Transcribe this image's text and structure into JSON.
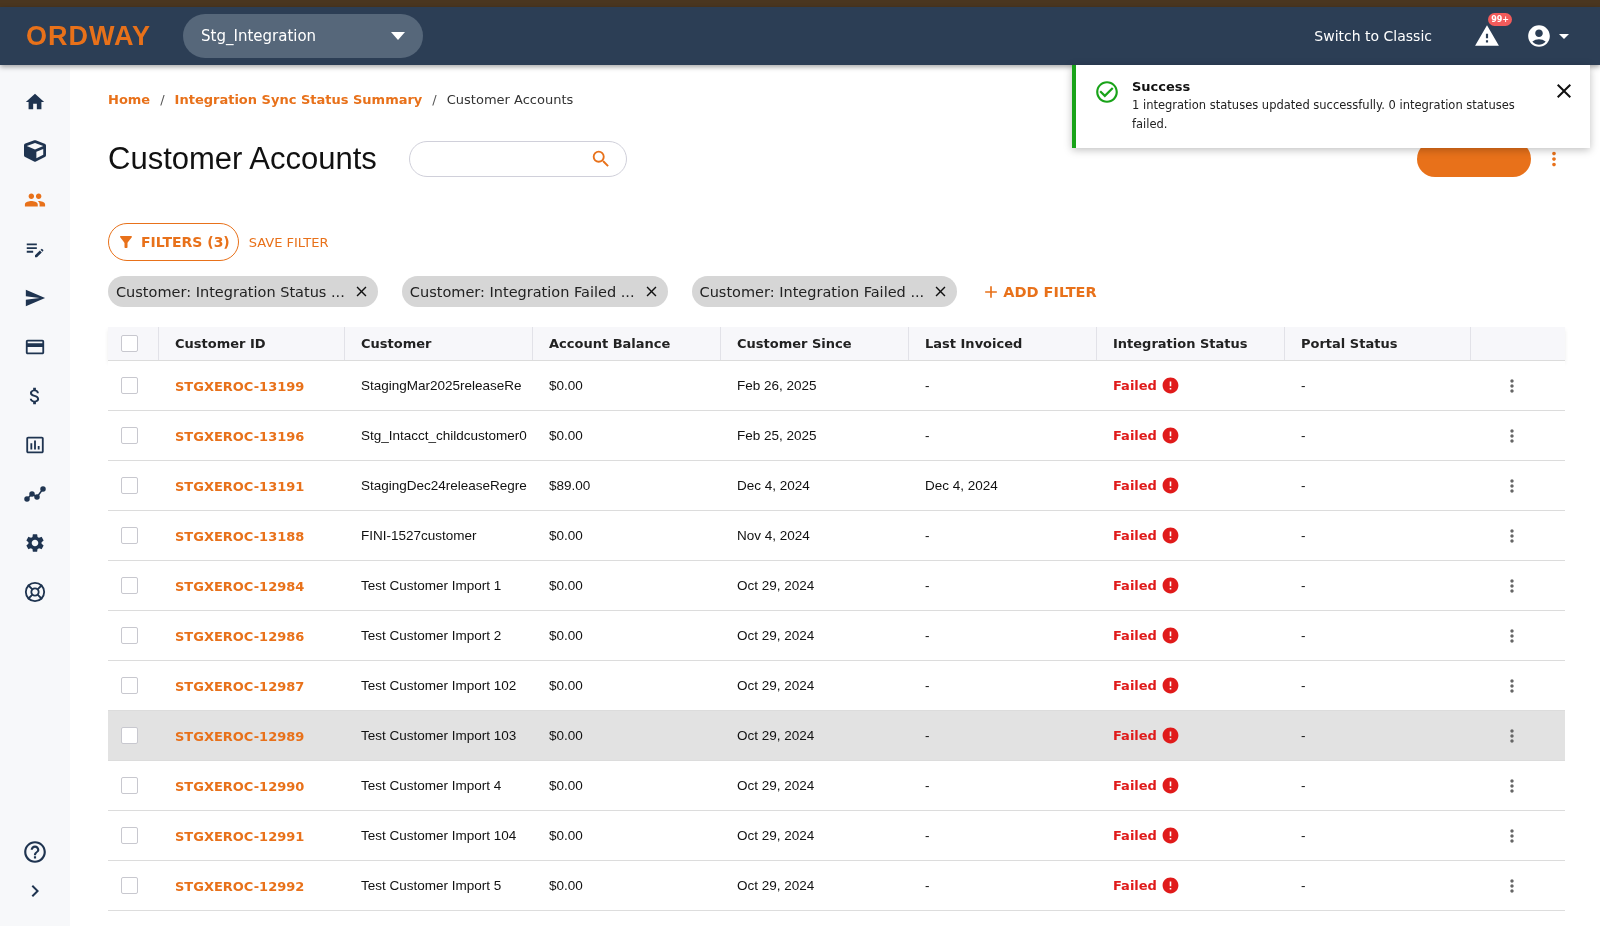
{
  "header": {
    "logo": "ORDWAY",
    "workspace": "Stg_Integration",
    "switch_link": "Switch to Classic",
    "alert_badge": "99+"
  },
  "sidebar": {
    "items": [
      {
        "selected": false
      },
      {
        "selected": false
      },
      {
        "selected": true
      },
      {
        "selected": false
      },
      {
        "selected": false
      },
      {
        "selected": false
      },
      {
        "selected": false
      },
      {
        "selected": false
      },
      {
        "selected": false
      },
      {
        "selected": false
      },
      {
        "selected": false
      }
    ]
  },
  "breadcrumb": [
    {
      "kind": "link",
      "label": "Home"
    },
    {
      "kind": "separator",
      "label": "/"
    },
    {
      "kind": "link",
      "label": "Integration Sync Status Summary"
    },
    {
      "kind": "separator",
      "label": "/"
    },
    {
      "kind": "current",
      "label": "Customer Accounts"
    }
  ],
  "title": "Customer Accounts",
  "select_all": {
    "checked": false
  },
  "filters": {
    "button": "FILTERS (3)",
    "save": "SAVE FILTER",
    "chips": [
      "Customer: Integration Status ...",
      "Customer: Integration Failed ...",
      "Customer: Integration Failed ..."
    ],
    "add": "ADD FILTER"
  },
  "table": {
    "columns": [
      "Customer ID",
      "Customer",
      "Account Balance",
      "Customer Since",
      "Last Invoiced",
      "Integration Status",
      "Portal Status"
    ],
    "rows": [
      {
        "id": "STGXEROC-13199",
        "customer": "StagingMar2025releaseRe",
        "balance": "$0.00",
        "since": "Feb 26, 2025",
        "last_invoiced": "-",
        "status": "Failed",
        "portal": "-",
        "checked": false,
        "hovered": false
      },
      {
        "id": "STGXEROC-13196",
        "customer": "Stg_Intacct_childcustomer0",
        "balance": "$0.00",
        "since": "Feb 25, 2025",
        "last_invoiced": "-",
        "status": "Failed",
        "portal": "-",
        "checked": false,
        "hovered": false
      },
      {
        "id": "STGXEROC-13191",
        "customer": "StagingDec24releaseRegre",
        "balance": "$89.00",
        "since": "Dec 4, 2024",
        "last_invoiced": "Dec 4, 2024",
        "status": "Failed",
        "portal": "-",
        "checked": false,
        "hovered": false
      },
      {
        "id": "STGXEROC-13188",
        "customer": "FINI-1527customer",
        "balance": "$0.00",
        "since": "Nov 4, 2024",
        "last_invoiced": "-",
        "status": "Failed",
        "portal": "-",
        "checked": false,
        "hovered": false
      },
      {
        "id": "STGXEROC-12984",
        "customer": "Test Customer Import 1",
        "balance": "$0.00",
        "since": "Oct 29, 2024",
        "last_invoiced": "-",
        "status": "Failed",
        "portal": "-",
        "checked": false,
        "hovered": false
      },
      {
        "id": "STGXEROC-12986",
        "customer": "Test Customer Import 2",
        "balance": "$0.00",
        "since": "Oct 29, 2024",
        "last_invoiced": "-",
        "status": "Failed",
        "portal": "-",
        "checked": false,
        "hovered": false
      },
      {
        "id": "STGXEROC-12987",
        "customer": "Test Customer Import 102",
        "balance": "$0.00",
        "since": "Oct 29, 2024",
        "last_invoiced": "-",
        "status": "Failed",
        "portal": "-",
        "checked": false,
        "hovered": false
      },
      {
        "id": "STGXEROC-12989",
        "customer": "Test Customer Import 103",
        "balance": "$0.00",
        "since": "Oct 29, 2024",
        "last_invoiced": "-",
        "status": "Failed",
        "portal": "-",
        "checked": false,
        "hovered": true
      },
      {
        "id": "STGXEROC-12990",
        "customer": "Test Customer Import 4",
        "balance": "$0.00",
        "since": "Oct 29, 2024",
        "last_invoiced": "-",
        "status": "Failed",
        "portal": "-",
        "checked": false,
        "hovered": false
      },
      {
        "id": "STGXEROC-12991",
        "customer": "Test Customer Import 104",
        "balance": "$0.00",
        "since": "Oct 29, 2024",
        "last_invoiced": "-",
        "status": "Failed",
        "portal": "-",
        "checked": false,
        "hovered": false
      },
      {
        "id": "STGXEROC-12992",
        "customer": "Test Customer Import 5",
        "balance": "$0.00",
        "since": "Oct 29, 2024",
        "last_invoiced": "-",
        "status": "Failed",
        "portal": "-",
        "checked": false,
        "hovered": false
      }
    ]
  },
  "toast": {
    "title": "Success",
    "message": "1 integration statuses updated successfully. 0 integration statuses failed."
  }
}
